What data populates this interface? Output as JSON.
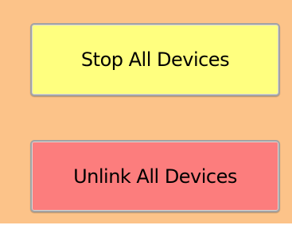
{
  "buttons": {
    "stop_all": {
      "label": "Stop All Devices",
      "color": "#ffff7f"
    },
    "unlink_all": {
      "label": "Unlink All Devices",
      "color": "#fc7d7d"
    }
  },
  "colors": {
    "panel_background": "#fcc389",
    "button_border": "#a3a3a3"
  }
}
